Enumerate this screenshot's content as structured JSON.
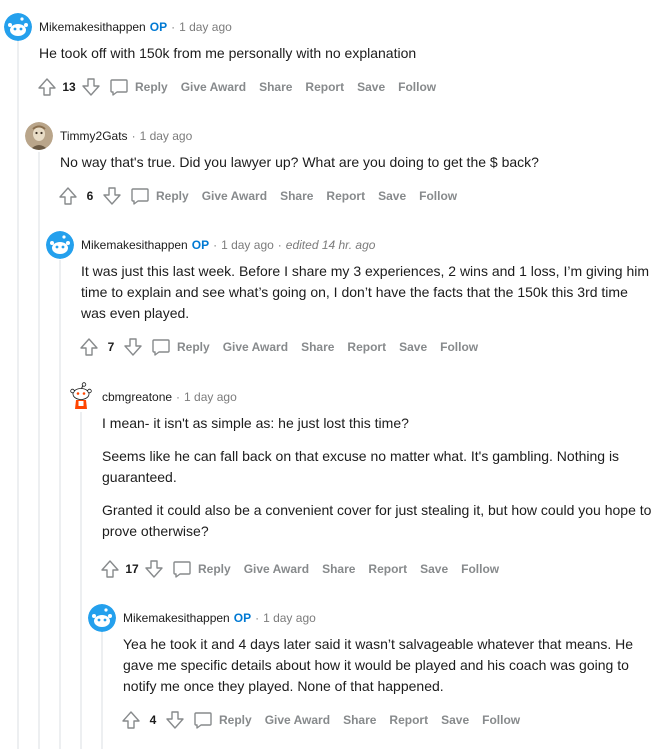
{
  "comments": [
    {
      "author": "Mikemakesithappen",
      "op_badge": "OP",
      "separator": "·",
      "time": "1 day ago",
      "edited": "",
      "avatar": "reddit-snoo-blue-avatar",
      "paragraphs": [
        "He took off with 150k from me personally with no explanation"
      ],
      "score": "13",
      "actions": {
        "reply": "Reply",
        "award": "Give Award",
        "share": "Share",
        "report": "Report",
        "save": "Save",
        "follow": "Follow"
      }
    },
    {
      "author": "Timmy2Gats",
      "op_badge": "",
      "separator": "·",
      "time": "1 day ago",
      "edited": "",
      "avatar": "photo-avatar",
      "paragraphs": [
        "No way that's true. Did you lawyer up? What are you doing to get the $ back?"
      ],
      "score": "6",
      "actions": {
        "reply": "Reply",
        "award": "Give Award",
        "share": "Share",
        "report": "Report",
        "save": "Save",
        "follow": "Follow"
      }
    },
    {
      "author": "Mikemakesithappen",
      "op_badge": "OP",
      "separator": "·",
      "time": "1 day ago",
      "edited": "edited 14 hr. ago",
      "avatar": "reddit-snoo-blue-avatar",
      "paragraphs": [
        "It was just this last week. Before I share my 3 experiences, 2 wins and 1 loss, I’m giving him time to explain and see what’s going on, I don’t have the facts that the 150k this 3rd time was even played."
      ],
      "score": "7",
      "actions": {
        "reply": "Reply",
        "award": "Give Award",
        "share": "Share",
        "report": "Report",
        "save": "Save",
        "follow": "Follow"
      }
    },
    {
      "author": "cbmgreatone",
      "op_badge": "",
      "separator": "·",
      "time": "1 day ago",
      "edited": "",
      "avatar": "reddit-snoo-red-avatar",
      "paragraphs": [
        "I mean- it isn't as simple as: he just lost this time?",
        "Seems like he can fall back on that excuse no matter what. It's gambling. Nothing is guaranteed.",
        "Granted it could also be a convenient cover for just stealing it, but how could you hope to prove otherwise?"
      ],
      "score": "17",
      "actions": {
        "reply": "Reply",
        "award": "Give Award",
        "share": "Share",
        "report": "Report",
        "save": "Save",
        "follow": "Follow"
      }
    },
    {
      "author": "Mikemakesithappen",
      "op_badge": "OP",
      "separator": "·",
      "time": "1 day ago",
      "edited": "",
      "avatar": "reddit-snoo-blue-avatar",
      "paragraphs": [
        "Yea he took it and 4 days later said it wasn’t salvageable whatever that means. He gave me specific details about how it would be played and his coach was going to notify me once they played. None of that happened."
      ],
      "score": "4",
      "actions": {
        "reply": "Reply",
        "award": "Give Award",
        "share": "Share",
        "report": "Report",
        "save": "Save",
        "follow": "Follow"
      }
    }
  ],
  "colors": {
    "op": "#0079d3",
    "action_text": "#878a8c",
    "meta_text": "#7c7c7c",
    "thread_line": "#edeff1",
    "snoo_blue": "#24a0ed"
  }
}
